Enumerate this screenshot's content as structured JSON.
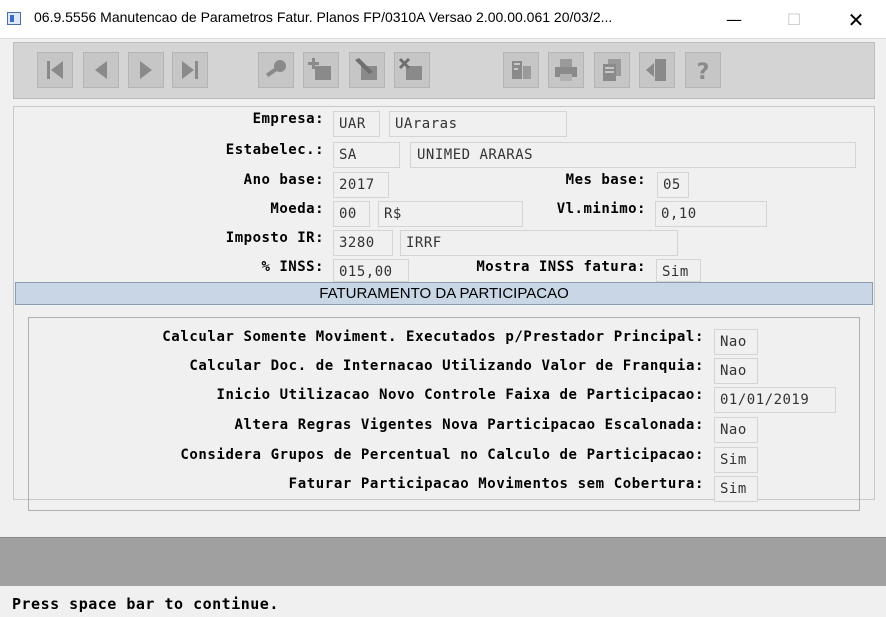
{
  "window": {
    "title": "06.9.5556 Manutencao  de Parametros Fatur. Planos FP/0310A Versao 2.00.00.061 20/03/2...",
    "minimize": "—",
    "maximize": "☐",
    "close": "✕"
  },
  "toolbar": {
    "buttons": [
      {
        "name": "first-record-icon"
      },
      {
        "name": "previous-record-icon"
      },
      {
        "name": "next-record-icon"
      },
      {
        "name": "last-record-icon"
      },
      {
        "name": "search-key-icon"
      },
      {
        "name": "add-record-icon"
      },
      {
        "name": "edit-record-icon"
      },
      {
        "name": "delete-record-icon"
      },
      {
        "name": "filter-icon"
      },
      {
        "name": "print-icon"
      },
      {
        "name": "copy-icon"
      },
      {
        "name": "exit-icon"
      },
      {
        "name": "help-icon"
      }
    ]
  },
  "form": {
    "empresa_label": "Empresa:",
    "empresa_code": "UAR",
    "empresa_name": "UAraras",
    "estabelec_label": "Estabelec.:",
    "estabelec_code": "SA",
    "estabelec_name": "UNIMED ARARAS",
    "ano_base_label": "Ano base:",
    "ano_base": "2017",
    "mes_base_label": "Mes base:",
    "mes_base": "05",
    "moeda_label": "Moeda:",
    "moeda_code": "00",
    "moeda_symbol": "R$",
    "vl_minimo_label": "Vl.minimo:",
    "vl_minimo": "0,10",
    "imposto_ir_label": "Imposto IR:",
    "imposto_ir_code": "3280",
    "imposto_ir_name": "IRRF",
    "inss_label": "% INSS:",
    "inss": "015,00",
    "mostra_inss_label": "Mostra INSS fatura:",
    "mostra_inss": "Sim"
  },
  "section": {
    "title": "FATURAMENTO DA PARTICIPACAO",
    "rows": [
      {
        "label": "Calcular Somente Moviment. Executados p/Prestador Principal:",
        "value": "Nao"
      },
      {
        "label": "Calcular Doc. de Internacao Utilizando Valor de Franquia:",
        "value": "Nao"
      },
      {
        "label": "Inicio Utilizacao Novo Controle Faixa de Participacao:",
        "value": "01/01/2019"
      },
      {
        "label": "Altera Regras Vigentes Nova Participacao Escalonada:",
        "value": "Nao"
      },
      {
        "label": "Considera Grupos de Percentual no Calculo de Participacao:",
        "value": "Sim"
      },
      {
        "label": "Faturar Participacao Movimentos sem Cobertura:",
        "value": "Sim"
      }
    ]
  },
  "status": {
    "message": "Press space bar to continue."
  }
}
